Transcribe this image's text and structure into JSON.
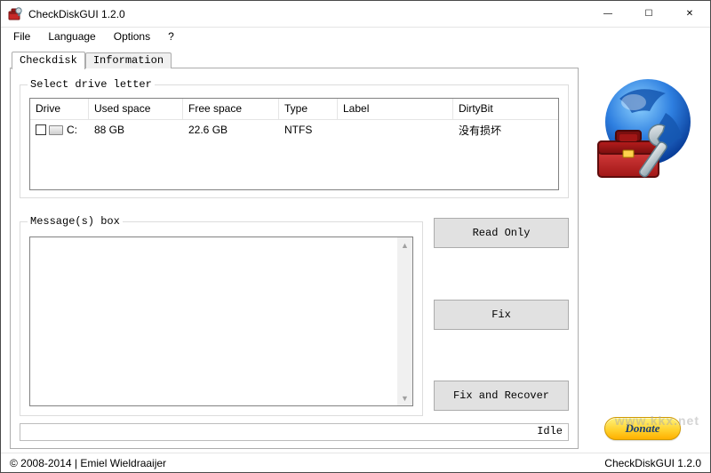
{
  "title": "CheckDiskGUI 1.2.0",
  "menus": {
    "file": "File",
    "language": "Language",
    "options": "Options",
    "help": "?"
  },
  "tabs": {
    "checkdisk": "Checkdisk",
    "information": "Information"
  },
  "groups": {
    "drives": "Select drive letter",
    "messages": "Message(s) box"
  },
  "drive_headers": {
    "drive": "Drive",
    "used": "Used space",
    "free": "Free space",
    "type": "Type",
    "label": "Label",
    "dirty": "DirtyBit"
  },
  "drives": [
    {
      "name": "C:",
      "used": "88 GB",
      "free": "22.6 GB",
      "type": "NTFS",
      "label": "",
      "dirty": "没有损坏"
    }
  ],
  "buttons": {
    "read_only": "Read Only",
    "fix": "Fix",
    "fix_recover": "Fix and Recover",
    "donate": "Donate"
  },
  "status": {
    "idle": "Idle",
    "copyright": "© 2008-2014 | Emiel Wieldraaijer",
    "app": "CheckDiskGUI 1.2.0"
  },
  "watermark": "www.kkx.net",
  "win": {
    "min": "—",
    "max": "☐",
    "close": "✕"
  }
}
